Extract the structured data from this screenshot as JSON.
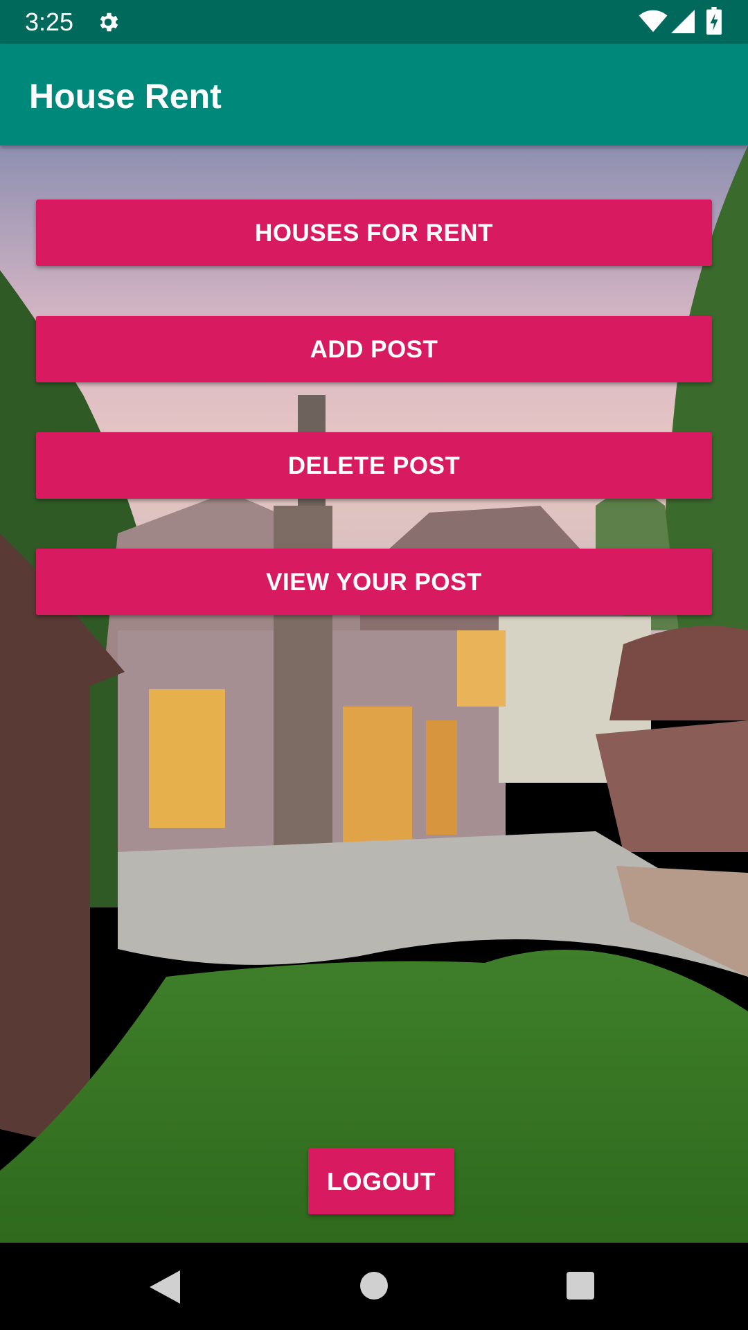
{
  "status_bar": {
    "time": "3:25",
    "icons": [
      "gear-icon",
      "wifi-icon",
      "signal-icon",
      "battery-charging-icon"
    ]
  },
  "app_bar": {
    "title": "House Rent",
    "color": "#00897b"
  },
  "menu": {
    "houses_for_rent": "HOUSES FOR RENT",
    "add_post": "ADD POST",
    "delete_post": "DELETE POST",
    "view_your_post": "VIEW YOUR POST",
    "logout": "LOGOUT",
    "button_color": "#d81b60"
  },
  "nav_bar": {
    "icons": [
      "back-icon",
      "home-icon",
      "recents-icon"
    ]
  }
}
